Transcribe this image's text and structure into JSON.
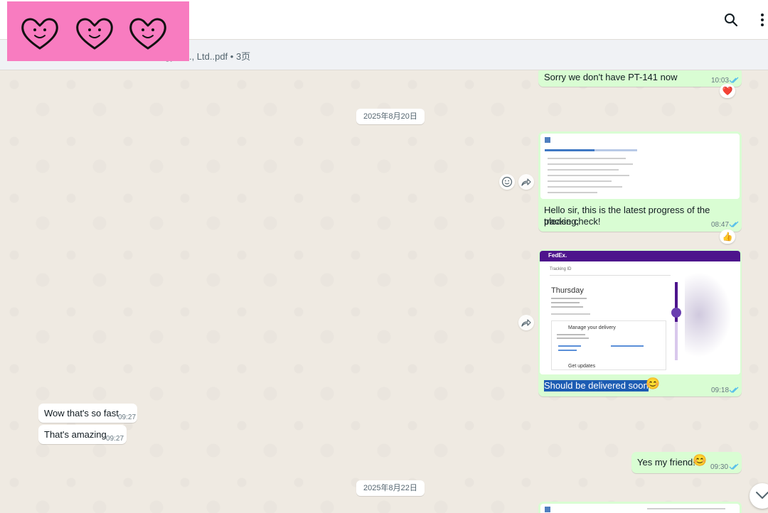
{
  "header": {
    "pinned_text": "gy Co., Ltd..pdf • 3页"
  },
  "stickers": [
    "smiling-heart",
    "smiling-heart",
    "smiling-heart"
  ],
  "dates": {
    "d1": "2025年8月20日",
    "d2": "2025年8月22日"
  },
  "messages": {
    "m1": {
      "text": "Sorry we don't have PT-141 now",
      "time": "10:03",
      "reaction": "❤️"
    },
    "m2": {
      "line1": "Hello sir, this is the latest progress of the tracking,",
      "line2": "please check!",
      "time": "08:47",
      "reaction": "👍"
    },
    "m3": {
      "fedex": {
        "logo": "FedEx.",
        "tracking_label": "Tracking ID",
        "day": "Thursday",
        "manage": "Manage your delivery",
        "updates": "Get updates"
      },
      "text": "Should be delivered soon",
      "emoji": "😊",
      "time": "09:18"
    },
    "m4": {
      "text": "Wow that's so fast",
      "time": "09:27"
    },
    "m5": {
      "text": "That's amazing",
      "time": "09:27"
    },
    "m6": {
      "text": "Yes my friend!",
      "emoji": "😊",
      "time": "09:30"
    }
  },
  "colors": {
    "outgoing_bubble": "#d9fdd3",
    "incoming_bubble": "#ffffff",
    "read_ticks": "#53bdeb",
    "sticker_bg": "#f87cc0",
    "fedex_purple": "#4d148c"
  }
}
